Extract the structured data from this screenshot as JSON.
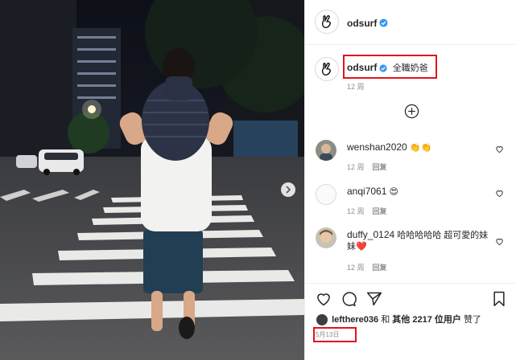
{
  "post": {
    "author": "odsurf",
    "caption": "全職奶爸",
    "caption_time": "12 周",
    "date": "5月13日",
    "likes": {
      "first_liker": "lefthere036",
      "and": "和",
      "others": "其他 2217 位用户",
      "suffix": "赞了"
    }
  },
  "comments": [
    {
      "user": "wenshan2020",
      "text": "👏👏",
      "time": "12 周",
      "reply": "回复"
    },
    {
      "user": "anqi7061",
      "text": "😍",
      "time": "12 周",
      "reply": "回复"
    },
    {
      "user": "duffy_0124",
      "text": "哈哈哈哈哈 超可愛的妹妹❤️",
      "time": "12 周",
      "reply": "回复"
    }
  ],
  "colors": {
    "highlight": "#e0141e",
    "verified": "#3897f0",
    "muted": "#8e8e8e"
  },
  "icons": [
    "hand-logo-icon",
    "verified-icon",
    "add-circle-icon",
    "heart-icon",
    "comment-icon",
    "share-icon",
    "bookmark-icon",
    "chevron-right-icon"
  ]
}
